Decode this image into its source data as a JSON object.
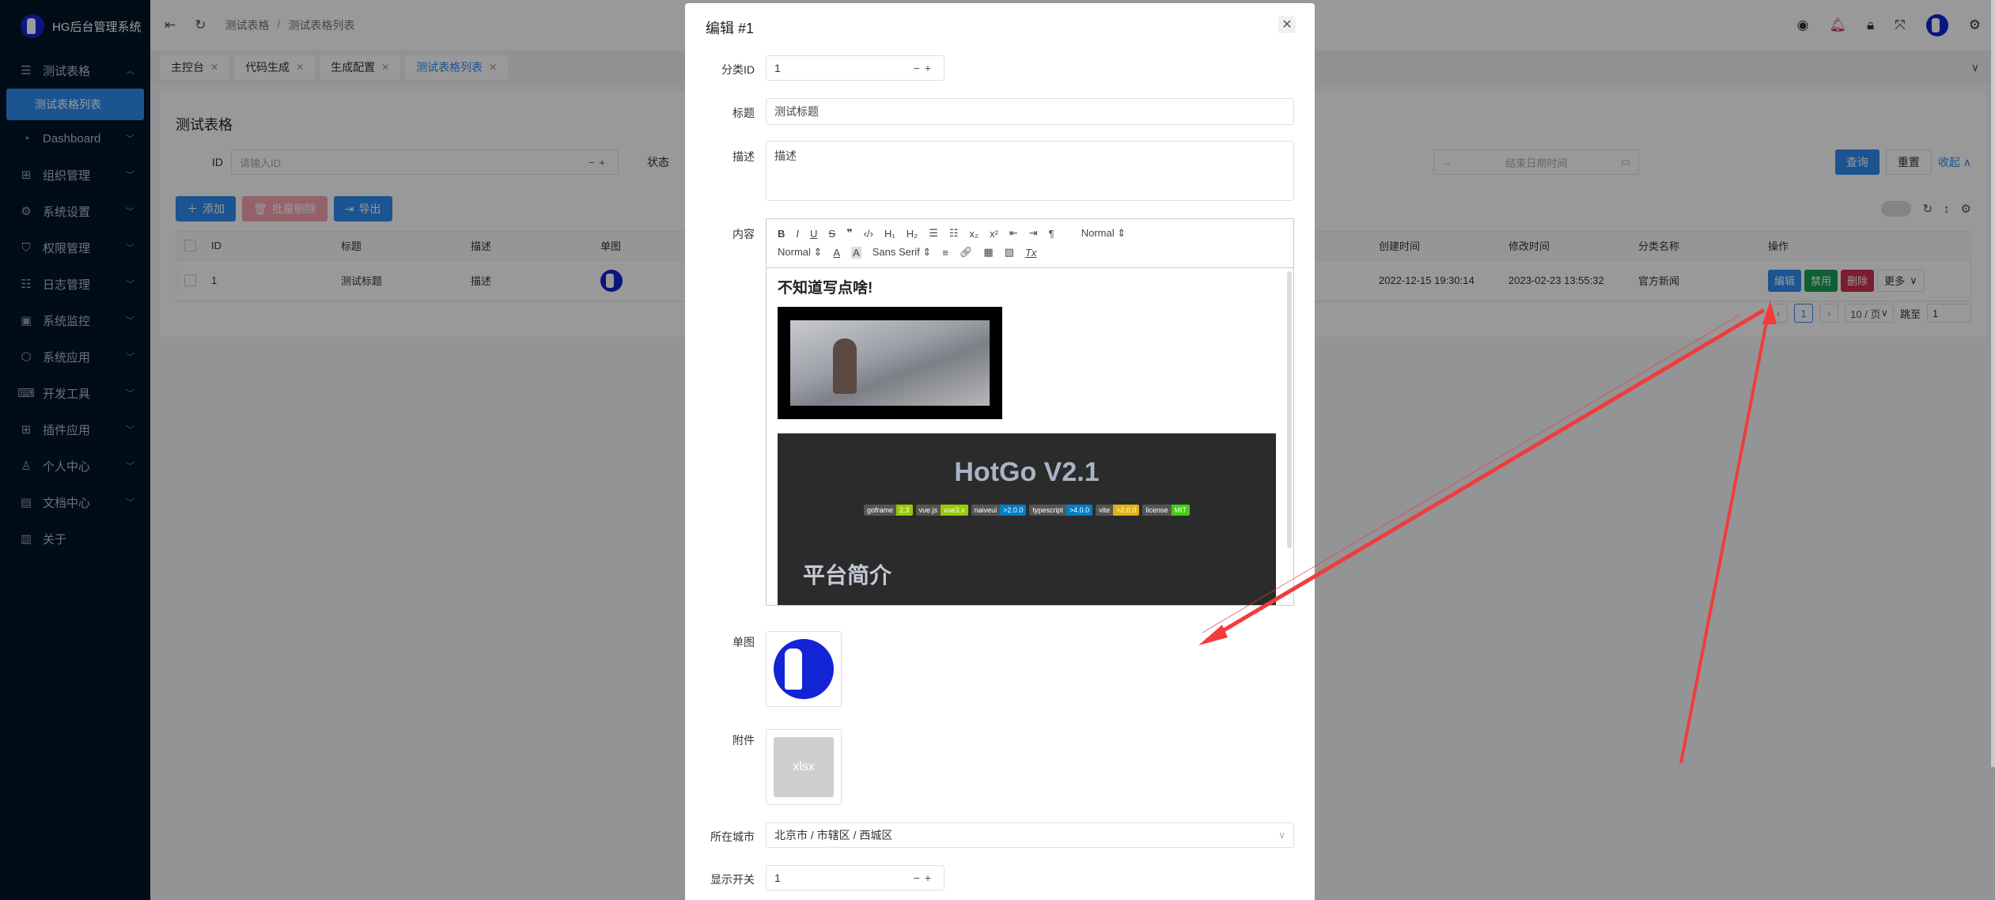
{
  "app": {
    "title": "HG后台管理系统"
  },
  "sidebar": {
    "items": [
      {
        "label": "测试表格",
        "icon": "menu-icon",
        "expanded": true
      },
      {
        "label": "Dashboard",
        "icon": "dashboard-icon"
      },
      {
        "label": "组织管理",
        "icon": "grid-icon"
      },
      {
        "label": "系统设置",
        "icon": "gear-icon"
      },
      {
        "label": "权限管理",
        "icon": "shield-icon"
      },
      {
        "label": "日志管理",
        "icon": "list-icon"
      },
      {
        "label": "系统监控",
        "icon": "monitor-icon"
      },
      {
        "label": "系统应用",
        "icon": "cube-icon"
      },
      {
        "label": "开发工具",
        "icon": "terminal-icon"
      },
      {
        "label": "插件应用",
        "icon": "grid-icon"
      },
      {
        "label": "个人中心",
        "icon": "user-icon"
      },
      {
        "label": "文档中心",
        "icon": "document-icon"
      },
      {
        "label": "关于",
        "icon": "board-icon"
      }
    ],
    "active_sub": "测试表格列表"
  },
  "header": {
    "breadcrumb": [
      "测试表格",
      "测试表格列表"
    ],
    "breadcrumb_sep": "/",
    "icons": [
      "github-icon",
      "bell-icon",
      "lock-icon",
      "fullscreen-icon",
      "avatar",
      "settings-icon"
    ]
  },
  "tabs": [
    {
      "label": "主控台",
      "active": false
    },
    {
      "label": "代码生成",
      "active": false
    },
    {
      "label": "生成配置",
      "active": false
    },
    {
      "label": "测试表格列表",
      "active": true
    }
  ],
  "page": {
    "title": "测试表格",
    "search": {
      "id_label": "ID",
      "id_placeholder": "请输入ID",
      "status_label": "状态",
      "end_date_placeholder": "结束日期时间",
      "query": "查询",
      "reset": "重置",
      "collapse": "收起"
    },
    "toolbar": {
      "add": "添加",
      "batch_delete": "批量删除",
      "export": "导出"
    },
    "table": {
      "columns": [
        "ID",
        "标题",
        "描述",
        "单图",
        "创建时间",
        "修改时间",
        "分类名称",
        "操作"
      ],
      "rows": [
        {
          "id": "1",
          "title": "测试标题",
          "desc": "描述",
          "created": "2022-12-15 19:30:14",
          "updated": "2023-02-23 13:55:32",
          "category": "官方新闻"
        }
      ],
      "actions": {
        "edit": "编辑",
        "disable": "禁用",
        "delete": "删除",
        "more": "更多"
      }
    },
    "pagination": {
      "current": "1",
      "page_size": "10 / 页",
      "jump_label": "跳至",
      "jump_value": "1"
    }
  },
  "modal": {
    "title": "编辑 #1",
    "fields": {
      "category_id": {
        "label": "分类ID",
        "value": "1"
      },
      "title": {
        "label": "标题",
        "value": "测试标题"
      },
      "description": {
        "label": "描述",
        "value": "描述"
      },
      "content": {
        "label": "内容"
      },
      "image": {
        "label": "单图"
      },
      "attachment": {
        "label": "附件",
        "file_ext": "xlsx"
      },
      "city": {
        "label": "所在城市",
        "value": "北京市 / 市辖区 / 西城区"
      },
      "switch": {
        "label": "显示开关",
        "value": "1"
      }
    },
    "editor": {
      "header_select": "Normal",
      "size_select": "Normal",
      "font_select": "Sans Serif",
      "heading": "不知道写点啥!",
      "banner_title": "HotGo V2.1",
      "badges": [
        {
          "key": "goframe",
          "val": "2.3",
          "color": "#97ca00"
        },
        {
          "key": "vue.js",
          "val": "vue3.x",
          "color": "#97ca00"
        },
        {
          "key": "naiveui",
          "val": ">2.0.0",
          "color": "#007ec6"
        },
        {
          "key": "typescript",
          "val": ">4.0.0",
          "color": "#007ec6"
        },
        {
          "key": "vite",
          "val": ">2.0.0",
          "color": "#dfb317"
        },
        {
          "key": "license",
          "val": "MIT",
          "color": "#4c1"
        }
      ],
      "banner_subtitle": "平台简介"
    }
  },
  "colors": {
    "primary": "#2d8cf0",
    "sidebar_bg": "#001529",
    "success": "#18a058",
    "danger": "#d03050",
    "annotation": "#f03c3c"
  }
}
